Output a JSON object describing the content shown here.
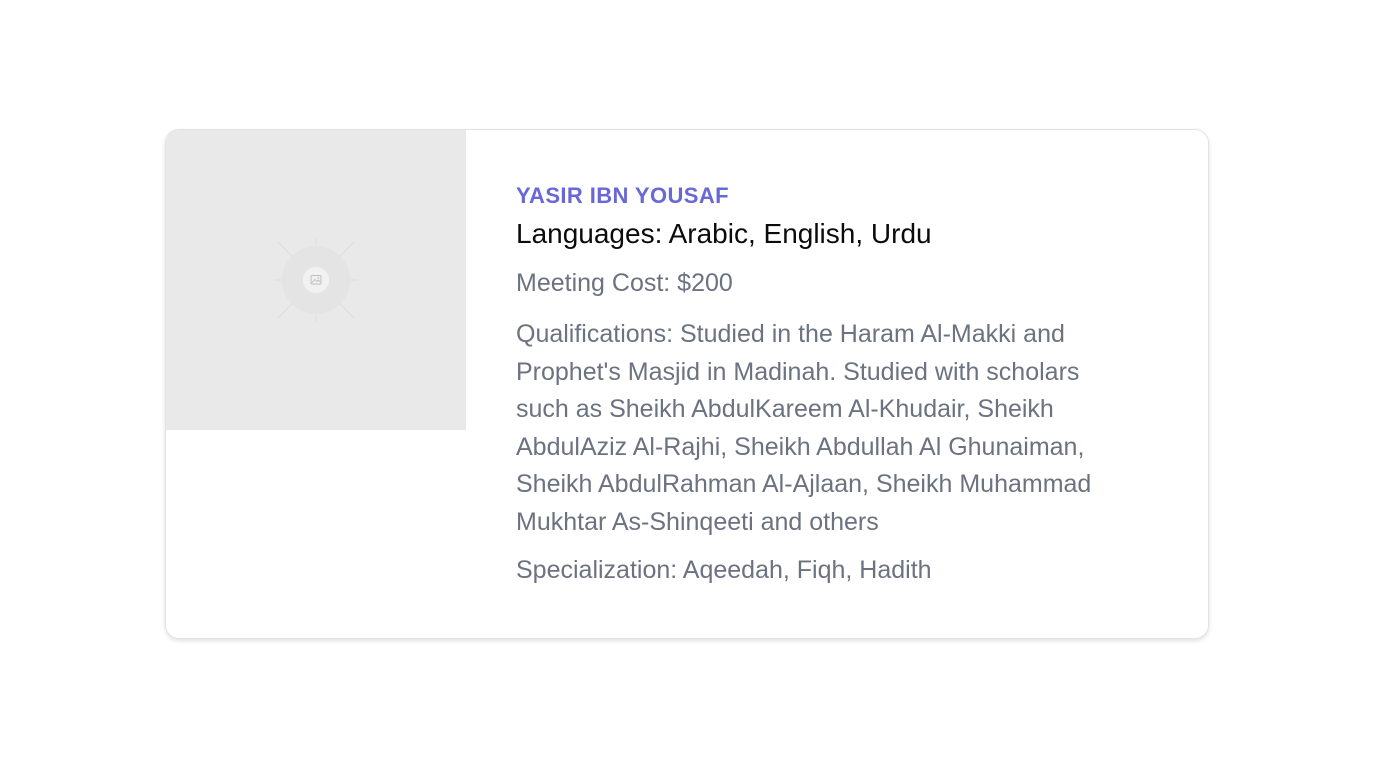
{
  "scholar": {
    "image_icon": "image-placeholder-icon",
    "name": "YASIR IBN YOUSAF",
    "languages": "Languages: Arabic, English, Urdu",
    "meeting_cost": "Meeting Cost: $200",
    "qualifications": "Qualifications: Studied in the Haram Al-Makki and Prophet's Masjid in Madinah. Studied with scholars such as Sheikh AbdulKareem Al-Khudair, Sheikh AbdulAziz Al-Rajhi, Sheikh Abdullah Al Ghunaiman, Sheikh AbdulRahman Al-Ajlaan, Sheikh Muhammad Mukhtar As-Shinqeeti and others",
    "specialization": "Specialization: Aqeedah, Fiqh, Hadith"
  },
  "colors": {
    "accent": "#6a67d6",
    "heading": "#0b0b0b",
    "muted": "#6b7280",
    "placeholder_bg": "#e9e9e9"
  }
}
